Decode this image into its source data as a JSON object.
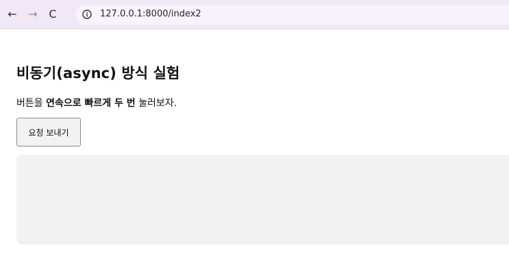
{
  "browser": {
    "back_icon": "←",
    "forward_icon": "→",
    "reload_icon": "C",
    "url": "127.0.0.1:8000/index2"
  },
  "page": {
    "title": "비동기(async) 방식 실험",
    "description": {
      "prefix": "버튼을 ",
      "emphasis": "연속으로 빠르게 두 번",
      "suffix": " 눌러보자."
    },
    "request_button_label": "요청 보내기",
    "result_text": ""
  },
  "colors": {
    "browser_toolbar": "#f0e8f4",
    "result_background": "#f2f2f2"
  }
}
